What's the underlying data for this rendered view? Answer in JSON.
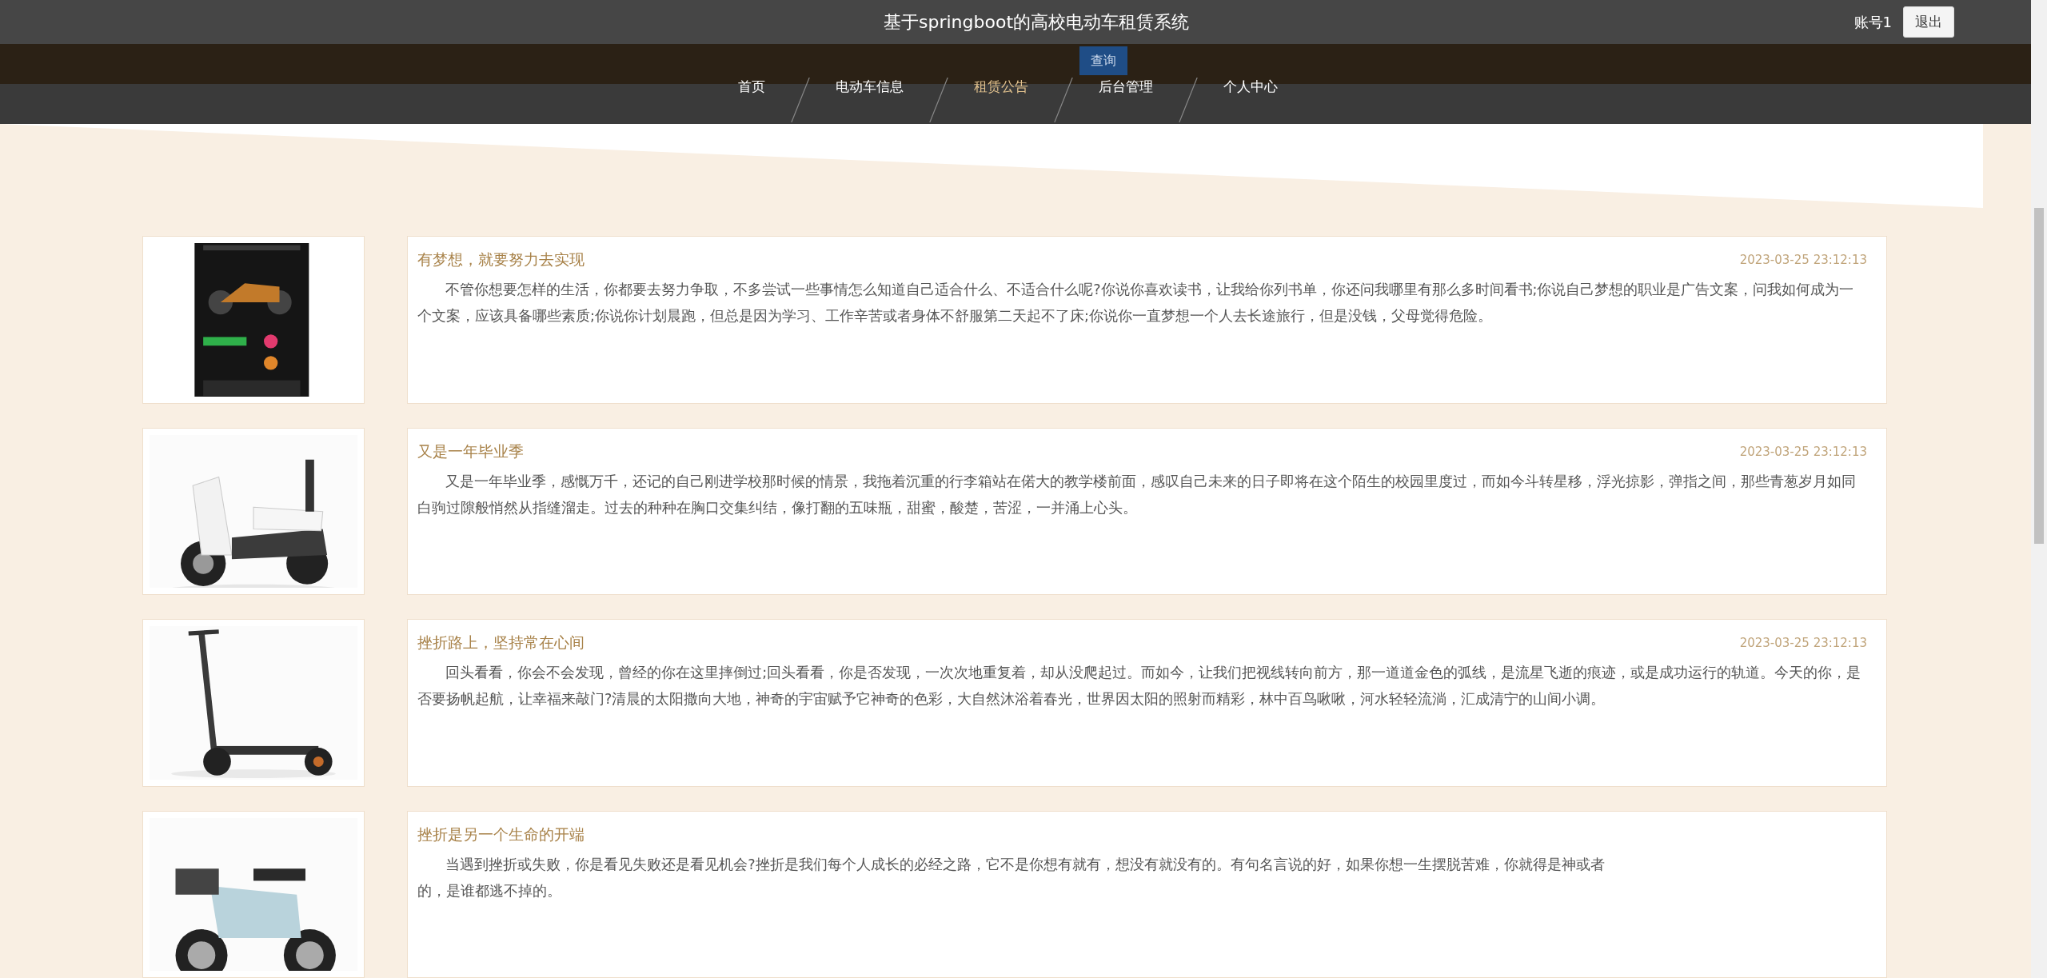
{
  "header": {
    "title": "基于springboot的高校电动车租赁系统",
    "user": "账号1",
    "logout": "退出"
  },
  "search": {
    "button": "查询"
  },
  "nav": [
    {
      "label": "首页",
      "selected": false
    },
    {
      "label": "电动车信息",
      "selected": false
    },
    {
      "label": "租赁公告",
      "selected": true
    },
    {
      "label": "后台管理",
      "selected": false
    },
    {
      "label": "个人中心",
      "selected": false
    }
  ],
  "notices": [
    {
      "kind": "phone",
      "title": "有梦想，就要努力去实现",
      "date": "2023-03-25 23:12:13",
      "body": "不管你想要怎样的生活，你都要去努力争取，不多尝试一些事情怎么知道自己适合什么、不适合什么呢?你说你喜欢读书，让我给你列书单，你还问我哪里有那么多时间看书;你说自己梦想的职业是广告文案，问我如何成为一个文案，应该具备哪些素质;你说你计划晨跑，但总是因为学习、工作辛苦或者身体不舒服第二天起不了床;你说你一直梦想一个人去长途旅行，但是没钱，父母觉得危险。"
    },
    {
      "kind": "scooter",
      "title": "又是一年毕业季",
      "date": "2023-03-25 23:12:13",
      "body": "又是一年毕业季，感慨万千，还记的自己刚进学校那时候的情景，我拖着沉重的行李箱站在偌大的教学楼前面，感叹自己未来的日子即将在这个陌生的校园里度过，而如今斗转星移，浮光掠影，弹指之间，那些青葱岁月如同白驹过隙般悄然从指缝溜走。过去的种种在胸口交集纠结，像打翻的五味瓶，甜蜜，酸楚，苦涩，一并涌上心头。"
    },
    {
      "kind": "kickscooter",
      "title": "挫折路上，坚持常在心间",
      "date": "2023-03-25 23:12:13",
      "body": "回头看看，你会不会发现，曾经的你在这里摔倒过;回头看看，你是否发现，一次次地重复着，却从没爬起过。而如今，让我们把视线转向前方，那一道道金色的弧线，是流星飞逝的痕迹，或是成功运行的轨道。今天的你，是否要扬帆起航，让幸福来敲门?清晨的太阳撒向大地，神奇的宇宙赋予它神奇的色彩，大自然沐浴着春光，世界因太阳的照射而精彩，林中百鸟啾啾，河水轻轻流淌，汇成清宁的山间小调。"
    },
    {
      "kind": "ebike",
      "title": "挫折是另一个生命的开端",
      "body": "当遇到挫折或失败，你是看见失败还是看见机会?挫折是我们每个人成长的必经之路，它不是你想有就有，想没有就没有的。有句名言说的好，如果你想一生摆脱苦难，你就得是神或者",
      "body_continued": "的，是谁都逃不掉的。"
    }
  ]
}
